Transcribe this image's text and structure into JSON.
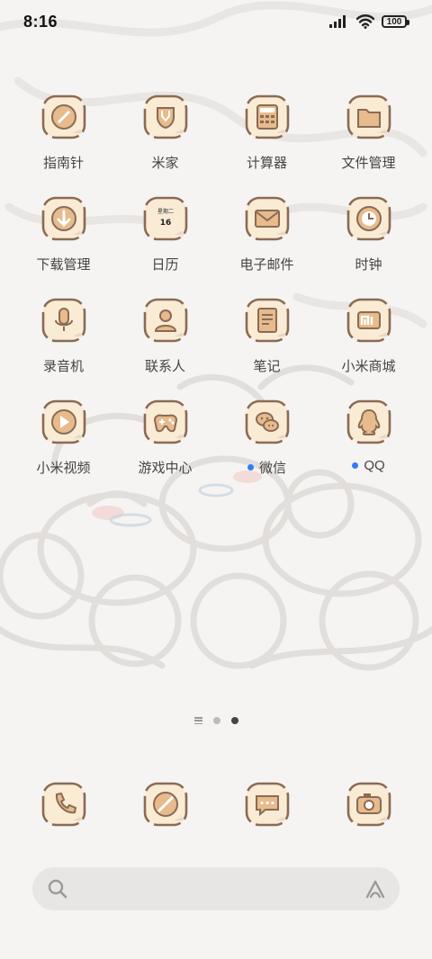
{
  "status": {
    "time": "8:16",
    "battery": "100"
  },
  "apps": [
    {
      "label": "指南针",
      "icon": "compass-icon",
      "dot": false
    },
    {
      "label": "米家",
      "icon": "mijia-icon",
      "dot": false
    },
    {
      "label": "计算器",
      "icon": "calculator-icon",
      "dot": false
    },
    {
      "label": "文件管理",
      "icon": "folder-icon",
      "dot": false
    },
    {
      "label": "下载管理",
      "icon": "download-icon",
      "dot": false
    },
    {
      "label": "日历",
      "icon": "calendar-icon",
      "dot": false,
      "icon_text": {
        "weekday": "星期二",
        "day": "16"
      }
    },
    {
      "label": "电子邮件",
      "icon": "mail-icon",
      "dot": false
    },
    {
      "label": "时钟",
      "icon": "clock-icon",
      "dot": false
    },
    {
      "label": "录音机",
      "icon": "microphone-icon",
      "dot": false
    },
    {
      "label": "联系人",
      "icon": "contacts-icon",
      "dot": false
    },
    {
      "label": "笔记",
      "icon": "notes-icon",
      "dot": false
    },
    {
      "label": "小米商城",
      "icon": "mi-store-icon",
      "dot": false
    },
    {
      "label": "小米视频",
      "icon": "video-icon",
      "dot": false
    },
    {
      "label": "游戏中心",
      "icon": "game-controller-icon",
      "dot": false
    },
    {
      "label": "微信",
      "icon": "wechat-icon",
      "dot": true
    },
    {
      "label": "QQ",
      "icon": "qq-penguin-icon",
      "dot": true
    }
  ],
  "dock": [
    {
      "icon": "phone-icon"
    },
    {
      "icon": "browser-icon"
    },
    {
      "icon": "messages-icon"
    },
    {
      "icon": "camera-icon"
    }
  ],
  "page_indicator": {
    "pages": 2,
    "active": 2
  },
  "colors": {
    "icon_fill": "#f9ebd4",
    "icon_stroke": "#8a6b55",
    "notification_dot": "#2f7df6"
  }
}
